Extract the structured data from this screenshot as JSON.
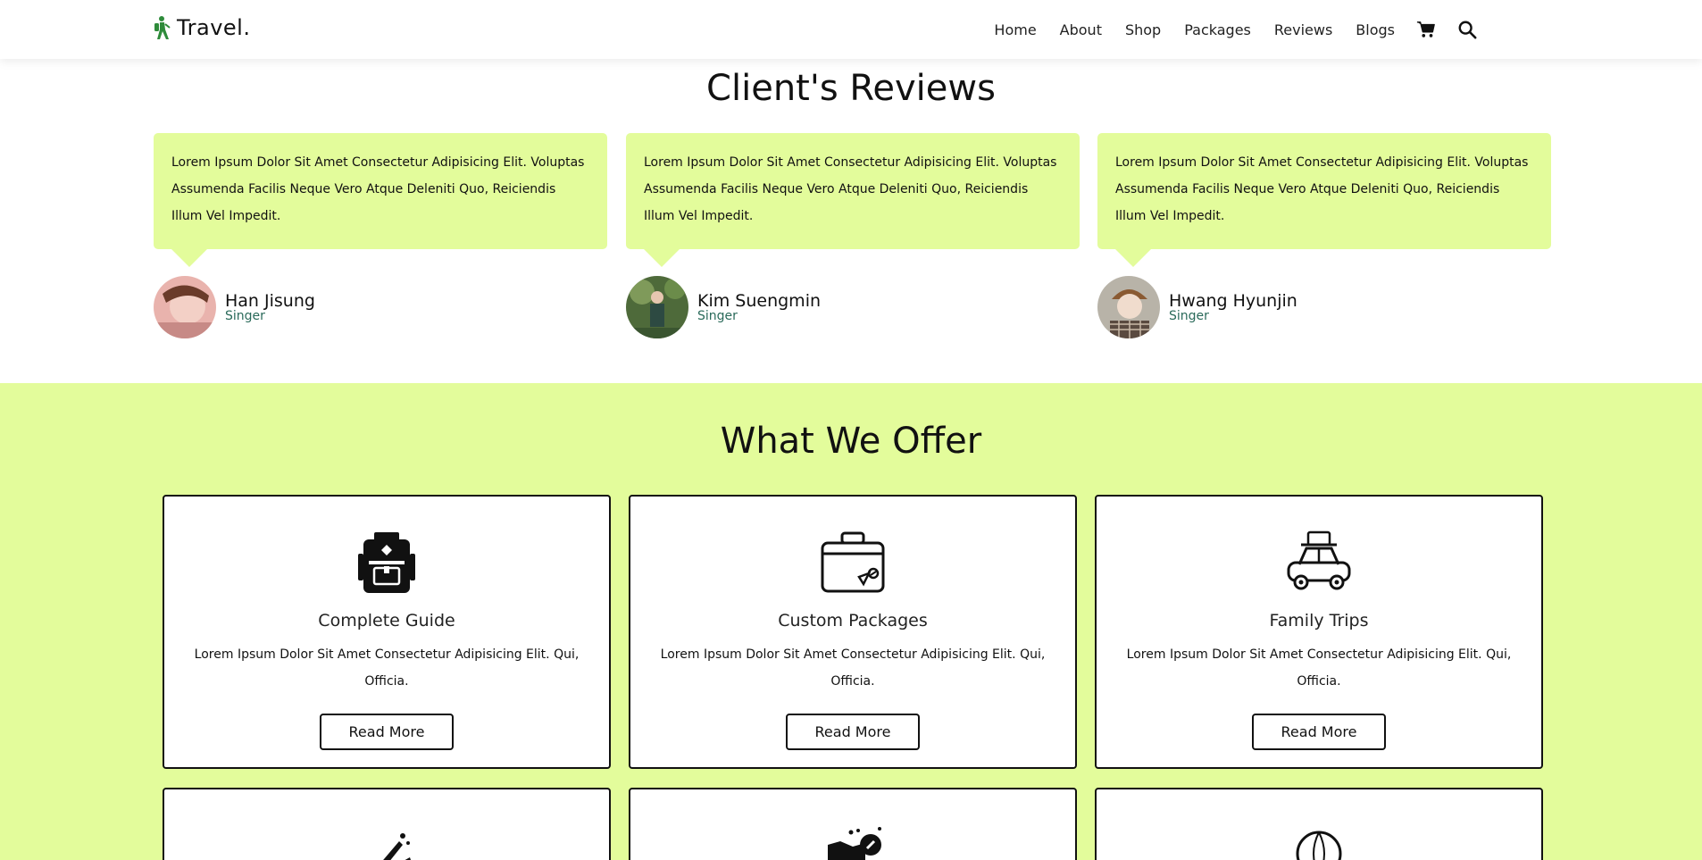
{
  "header": {
    "logo": "Travel.",
    "nav": [
      "Home",
      "About",
      "Shop",
      "Packages",
      "Reviews",
      "Blogs"
    ]
  },
  "reviews": {
    "title": "Client's Reviews",
    "items": [
      {
        "text": "Lorem Ipsum Dolor Sit Amet Consectetur Adipisicing Elit. Voluptas Assumenda Facilis Neque Vero Atque Deleniti Quo, Reiciendis Illum Vel Impedit.",
        "name": "Han Jisung",
        "role": "Singer"
      },
      {
        "text": "Lorem Ipsum Dolor Sit Amet Consectetur Adipisicing Elit. Voluptas Assumenda Facilis Neque Vero Atque Deleniti Quo, Reiciendis Illum Vel Impedit.",
        "name": "Kim Suengmin",
        "role": "Singer"
      },
      {
        "text": "Lorem Ipsum Dolor Sit Amet Consectetur Adipisicing Elit. Voluptas Assumenda Facilis Neque Vero Atque Deleniti Quo, Reiciendis Illum Vel Impedit.",
        "name": "Hwang Hyunjin",
        "role": "Singer"
      }
    ]
  },
  "offer": {
    "title": "What We Offer",
    "cards": [
      {
        "title": "Complete Guide",
        "text": "Lorem Ipsum Dolor Sit Amet Consectetur Adipisicing Elit. Qui, Officia.",
        "button": "Read More"
      },
      {
        "title": "Custom Packages",
        "text": "Lorem Ipsum Dolor Sit Amet Consectetur Adipisicing Elit. Qui, Officia.",
        "button": "Read More"
      },
      {
        "title": "Family Trips",
        "text": "Lorem Ipsum Dolor Sit Amet Consectetur Adipisicing Elit. Qui, Officia.",
        "button": "Read More"
      }
    ]
  },
  "colors": {
    "accent": "#e3fc9b",
    "logo_green": "#2e8b3a"
  }
}
